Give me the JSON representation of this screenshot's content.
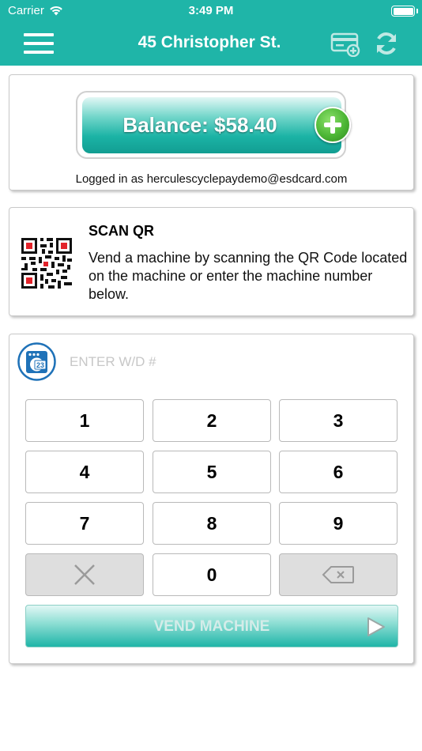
{
  "status_bar": {
    "carrier": "Carrier",
    "time": "3:49 PM"
  },
  "nav": {
    "title": "45 Christopher St.",
    "icons": [
      "menu-icon",
      "card-add-icon",
      "refresh-icon"
    ]
  },
  "balance": {
    "label": "Balance: $58.40",
    "logged_in": "Logged in as herculescyclepaydemo@esdcard.com"
  },
  "scan": {
    "title": "SCAN QR",
    "description": "Vend a machine by scanning the QR Code located on the machine or enter the machine number below."
  },
  "keypad": {
    "machine_icon_number": "23",
    "input_placeholder": "ENTER W/D #",
    "input_value": "",
    "keys": [
      "1",
      "2",
      "3",
      "4",
      "5",
      "6",
      "7",
      "8",
      "9",
      "0"
    ],
    "vend_label": "VEND MACHINE"
  },
  "colors": {
    "header": "#1fb5a8",
    "accent_green": "#4cb635",
    "machine_icon": "#1f72b8"
  }
}
